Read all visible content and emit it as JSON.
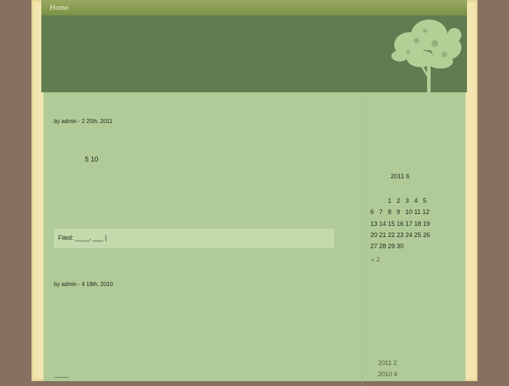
{
  "nav": {
    "home_label": "Home"
  },
  "posts": [
    {
      "meta": "by admin - 2  25th, 2011",
      "body": "5   10",
      "filed": "Filed: ____, ___ |"
    },
    {
      "meta": "by admin - 4  18th, 2010",
      "link": "____"
    }
  ],
  "calendar": {
    "caption": "2011 6",
    "rows": [
      "          1   2   3   4   5",
      "6   7   8   9   10 11 12",
      "13 14 15 16 17 18 19",
      "20 21 22 23 24 25 26",
      "27 28 29 30"
    ],
    "prev": "« 2"
  },
  "archives": [
    "2011 2",
    "2010 4"
  ],
  "colors": {
    "page_bg": "#86705f",
    "frame": "#f2e6b0",
    "header": "#627c52",
    "content": "#b0cb98",
    "filed_bar": "#c3dbac"
  }
}
